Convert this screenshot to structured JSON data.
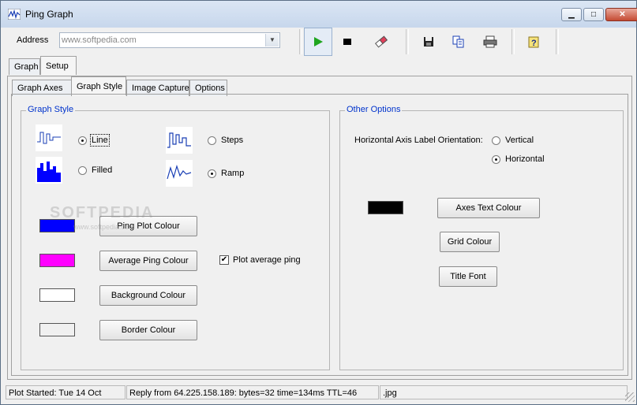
{
  "window": {
    "title": "Ping Graph"
  },
  "caption_buttons": {
    "minimize": "▁",
    "maximize": "□",
    "close": "✕"
  },
  "address": {
    "label": "Address",
    "value": "www.softpedia.com"
  },
  "toolbar": {
    "icons": [
      "play-icon",
      "stop-icon",
      "eraser-icon",
      "save-icon",
      "copy-icon",
      "print-icon",
      "help-icon"
    ]
  },
  "tabs": {
    "outer": [
      "Graph",
      "Setup"
    ],
    "outer_active": "Setup",
    "inner": [
      "Graph Axes",
      "Graph Style",
      "Image Capture",
      "Options"
    ],
    "inner_active": "Graph Style"
  },
  "graph_style": {
    "legend": "Graph Style",
    "options": {
      "line": "Line",
      "steps": "Steps",
      "filled": "Filled",
      "ramp": "Ramp"
    },
    "selected": [
      "Line",
      "Ramp"
    ]
  },
  "colours": {
    "ping_plot": {
      "label": "Ping Plot Colour",
      "color": "#0000ff"
    },
    "average_ping": {
      "label": "Average Ping Colour",
      "color": "#ff00ff"
    },
    "background": {
      "label": "Background Colour",
      "color": "#ffffff"
    },
    "border": {
      "label": "Border Colour",
      "color": "#f0f0f0"
    }
  },
  "plot_average": {
    "label": "Plot average ping",
    "checked": true,
    "mark": "✔"
  },
  "other_options": {
    "legend": "Other Options",
    "orientation_label": "Horizontal Axis Label Orientation:",
    "vertical": "Vertical",
    "horizontal": "Horizontal",
    "selected": "Horizontal",
    "axes_text_colour": {
      "label": "Axes Text Colour",
      "color": "#000000"
    },
    "grid_colour": "Grid Colour",
    "title_font": "Title Font"
  },
  "watermark": {
    "text": "SOFTPEDIA",
    "sub": "www.softpedia.com"
  },
  "status": {
    "started": "Plot Started: Tue 14 Oct",
    "reply": "Reply from 64.225.158.189: bytes=32 time=134ms TTL=46",
    "file": ".jpg"
  }
}
